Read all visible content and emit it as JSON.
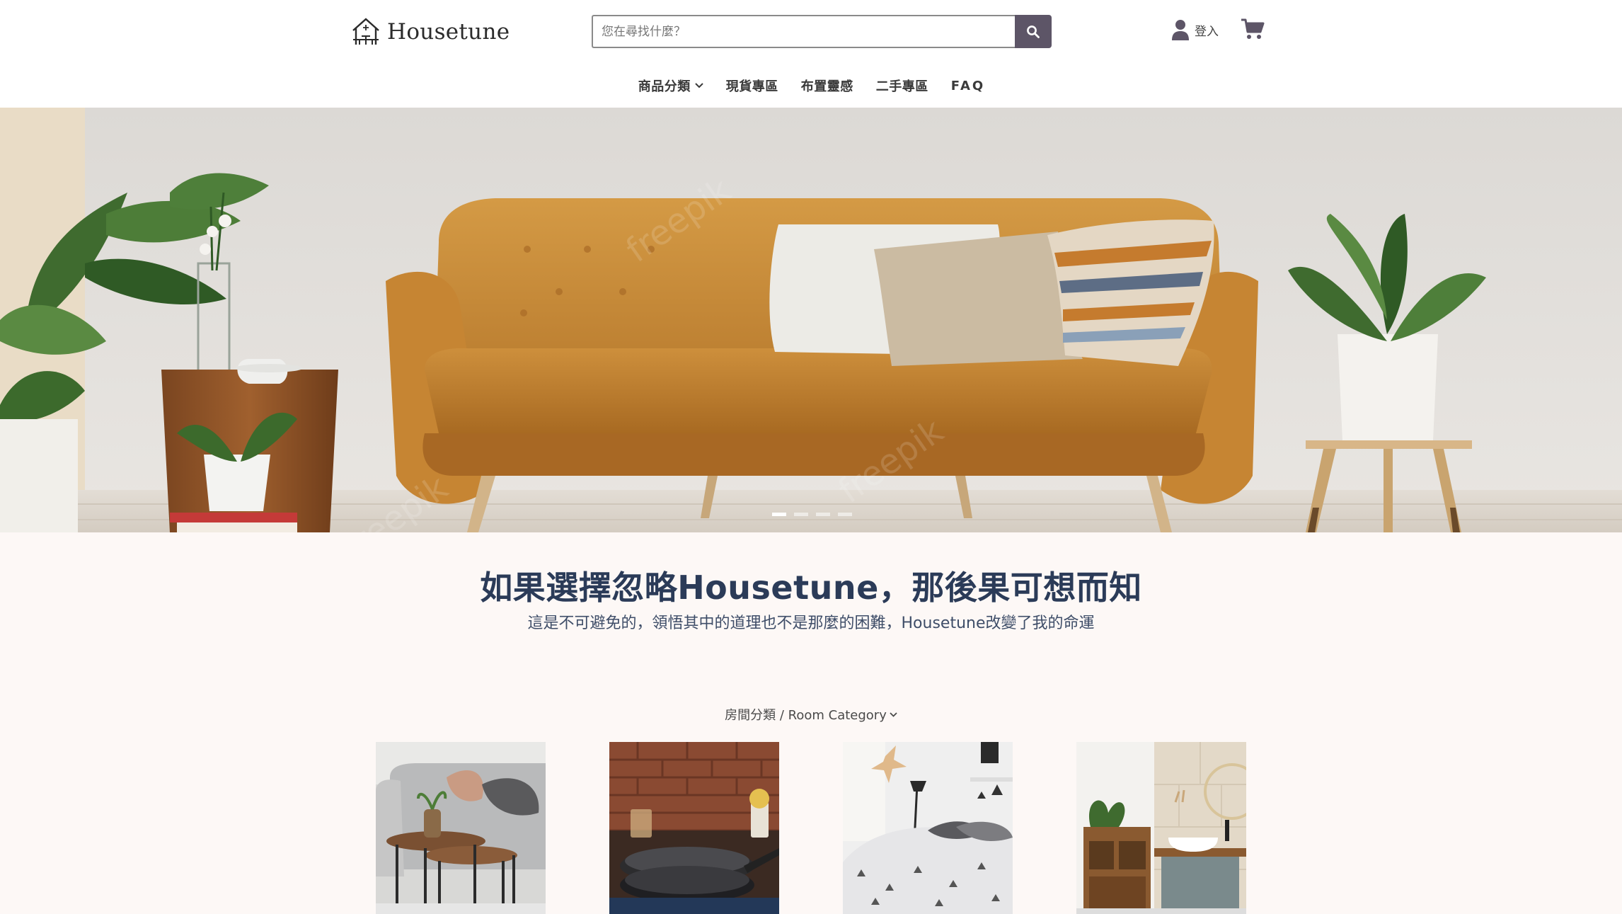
{
  "brand": {
    "name": "Housetune"
  },
  "search": {
    "placeholder": "您在尋找什麼？"
  },
  "header": {
    "login_label": "登入"
  },
  "nav": {
    "items": [
      {
        "label": "商品分類",
        "has_dropdown": true
      },
      {
        "label": "現貨專區"
      },
      {
        "label": "布置靈感"
      },
      {
        "label": "二手專區"
      },
      {
        "label": "FAQ"
      }
    ]
  },
  "hero": {
    "slides": 4,
    "active_slide": 1
  },
  "intro": {
    "headline": "如果選擇忽略Housetune，那後果可想而知",
    "subline": "這是不可避免的，領悟其中的道理也不是那麼的困難，Housetune改變了我的命運"
  },
  "rooms": {
    "label": "房間分類 / Room Category",
    "items": [
      {
        "name": "living-room",
        "icon": "living-room-photo"
      },
      {
        "name": "kitchen",
        "icon": "kitchen-photo"
      },
      {
        "name": "bedroom",
        "icon": "bedroom-photo"
      },
      {
        "name": "bathroom",
        "icon": "bathroom-photo"
      }
    ]
  },
  "colors": {
    "accent": "#5d5567",
    "headline": "#2b3b58",
    "content_bg": "#fdf8f6"
  }
}
